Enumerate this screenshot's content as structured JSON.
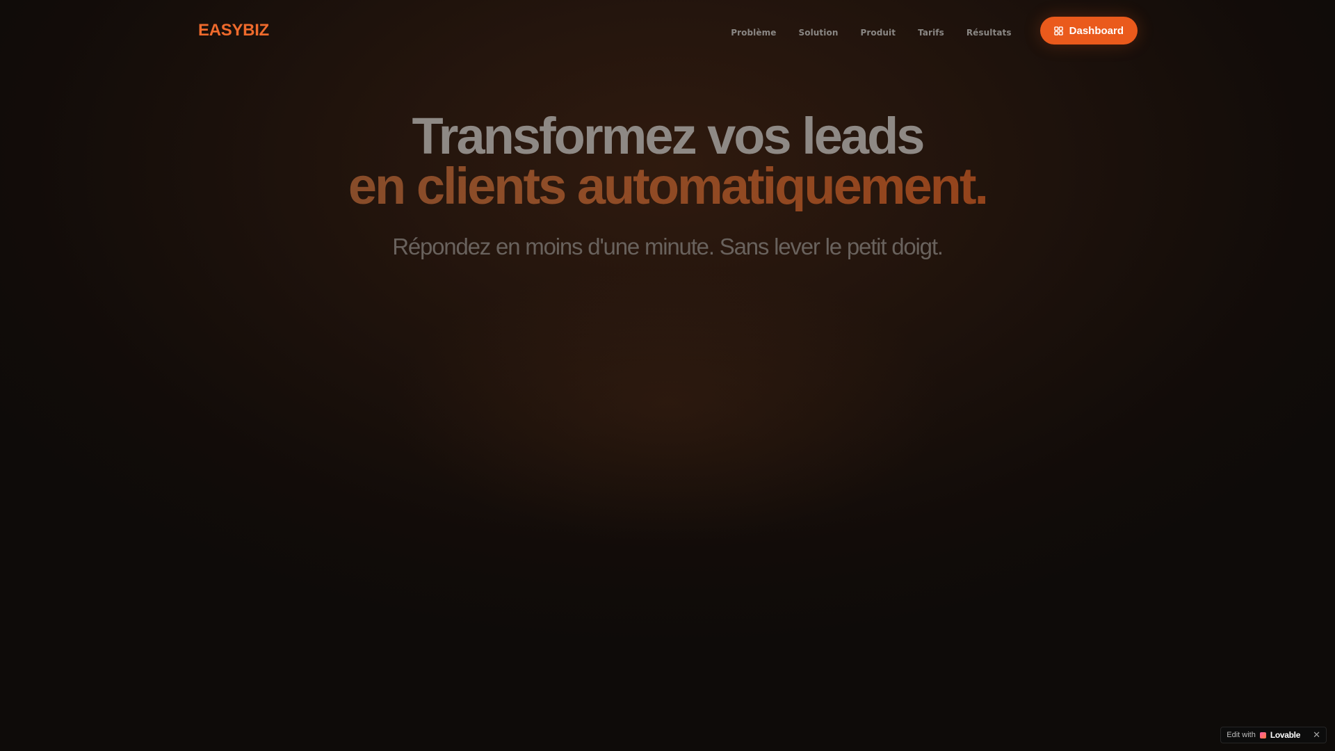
{
  "brand": {
    "logo_text": "EASYBIZ",
    "accent_color": "#ea5a1c"
  },
  "nav": {
    "links": [
      {
        "label": "Problème"
      },
      {
        "label": "Solution"
      },
      {
        "label": "Produit"
      },
      {
        "label": "Tarifs"
      },
      {
        "label": "Résultats"
      }
    ],
    "cta": {
      "label": "Dashboard",
      "icon": "grid-icon"
    }
  },
  "hero": {
    "title_line1": "Transformez vos leads",
    "title_line2": "en clients automatiquement.",
    "subtitle": "Répondez en moins d'une minute. Sans lever le petit doigt."
  },
  "badge": {
    "edit_label": "Edit with",
    "brand": "Lovable",
    "close_icon": "close-icon"
  }
}
